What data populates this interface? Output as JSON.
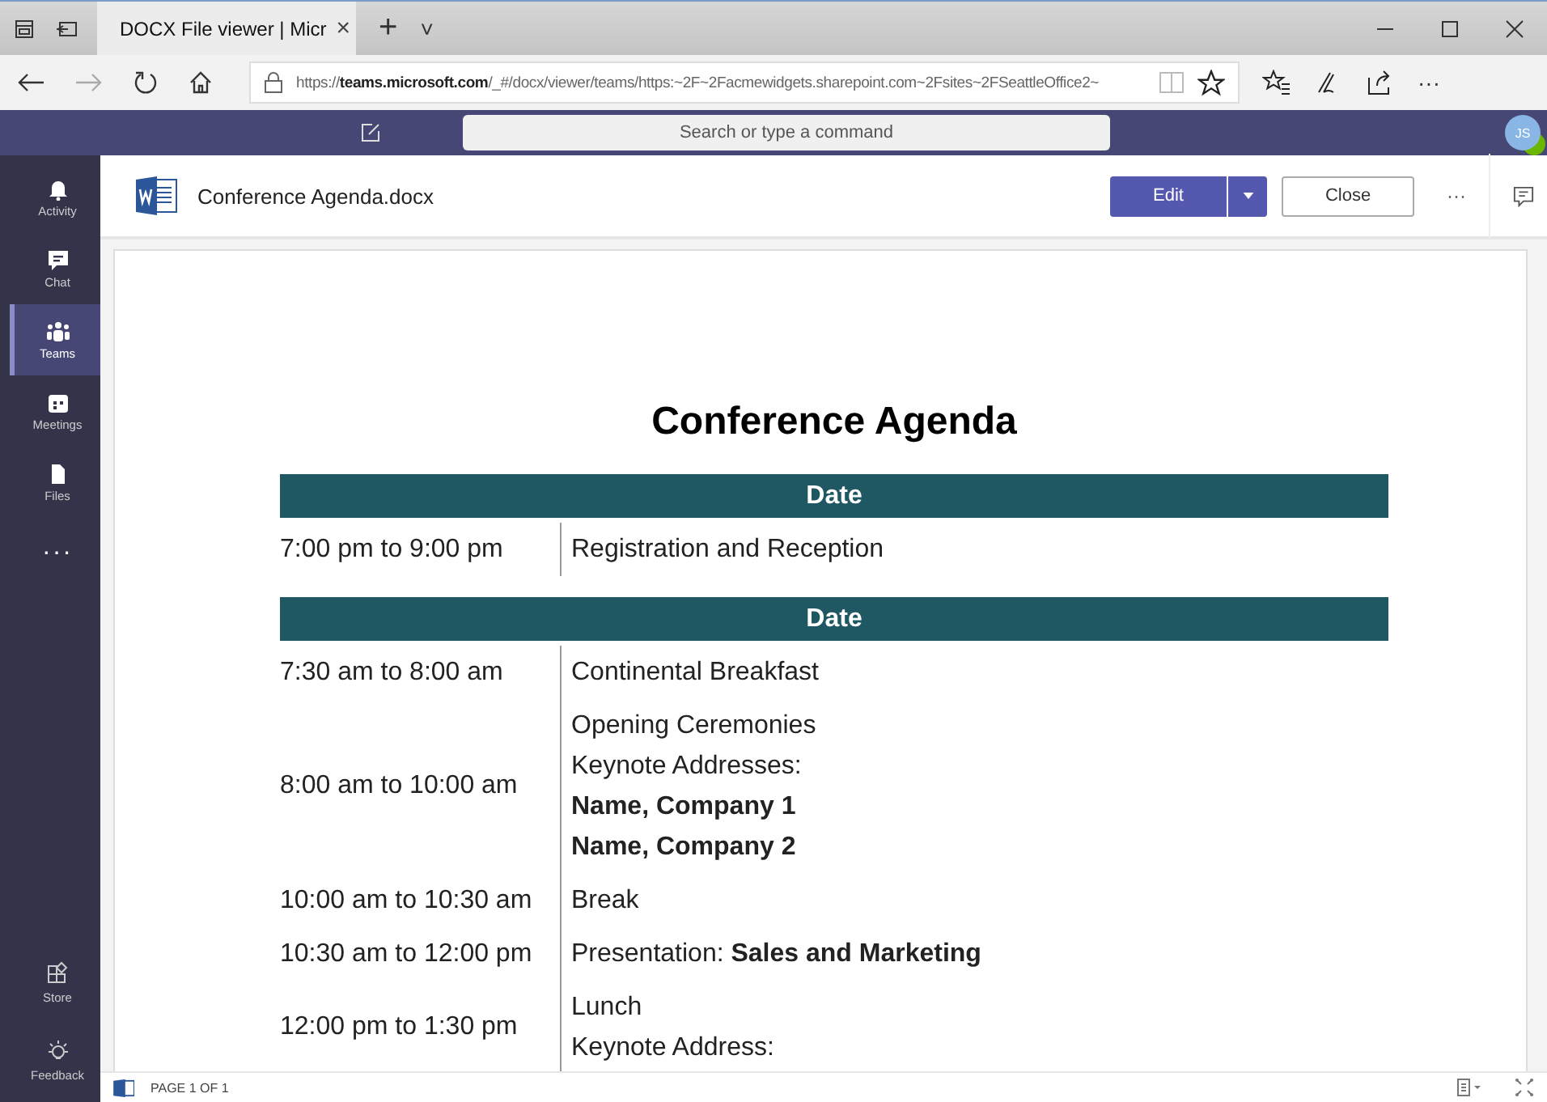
{
  "browser": {
    "tabs": [
      {
        "title": "DOCX File viewer | Micr",
        "close": "×",
        "selected": true
      }
    ],
    "new_tab": "+",
    "tab_menu": "˅",
    "address": "https://**teams.microsoft.com**/_#/docx/viewer/teams/https:~2F~2Facmewidgets.sharepoint.com~2Fsites~2FSeattleOffice2~",
    "more": "···"
  },
  "teams_bar": {
    "search": {
      "placeholder": "Search or type a command"
    },
    "avatar": {
      "initials": "JS"
    }
  },
  "rail": {
    "items": [
      {
        "label": "Activity",
        "kind": "bell",
        "selected": false
      },
      {
        "label": "Chat",
        "kind": "chat",
        "selected": false
      },
      {
        "label": "Teams",
        "kind": "teams",
        "selected": true
      },
      {
        "label": "Meetings",
        "kind": "calendar",
        "selected": false
      },
      {
        "label": "Files",
        "kind": "file",
        "selected": false
      },
      {
        "label": "···",
        "kind": "more",
        "selected": false
      }
    ],
    "bottom_items": [
      {
        "label": "Store",
        "kind": "store",
        "selected": false
      },
      {
        "label": "Feedback",
        "kind": "bulb",
        "selected": false
      }
    ]
  },
  "doc_header": {
    "file_name": "Conference Agenda.docx",
    "buttons": {
      "edit": "Edit",
      "close": "Close",
      "more": "···"
    }
  },
  "document": {
    "title": "Conference Agenda",
    "sections": [
      {
        "header": "Date",
        "rows": [
          {
            "time": "7:00 pm to 9:00 pm",
            "lines": [
              {
                "text": "Registration and Reception",
                "bold": false
              }
            ]
          }
        ]
      },
      {
        "header": "Date",
        "rows": [
          {
            "time": "7:30 am to 8:00 am",
            "lines": [
              {
                "text": "Continental Breakfast",
                "bold": false
              }
            ]
          },
          {
            "time": "8:00 am to 10:00 am",
            "lines": [
              {
                "text": "Opening Ceremonies",
                "bold": false
              },
              {
                "text": "Keynote Addresses:",
                "bold": false
              },
              {
                "text": "Name, Company 1",
                "bold": true
              },
              {
                "text": "Name, Company 2",
                "bold": true
              }
            ]
          },
          {
            "time": "10:00 am to 10:30 am",
            "lines": [
              {
                "text": "Break",
                "bold": false
              }
            ]
          },
          {
            "time": "10:30 am to 12:00 pm",
            "lines": [
              {
                "text": "Presentation:  **Sales and Marketing**",
                "bold": false
              }
            ]
          },
          {
            "time": "12:00 pm to 1:30 pm",
            "lines": [
              {
                "text": "Lunch",
                "bold": false
              },
              {
                "text": "Keynote Address:",
                "bold": false
              }
            ]
          }
        ]
      }
    ]
  },
  "status_bar": {
    "page": "PAGE 1 OF 1"
  }
}
